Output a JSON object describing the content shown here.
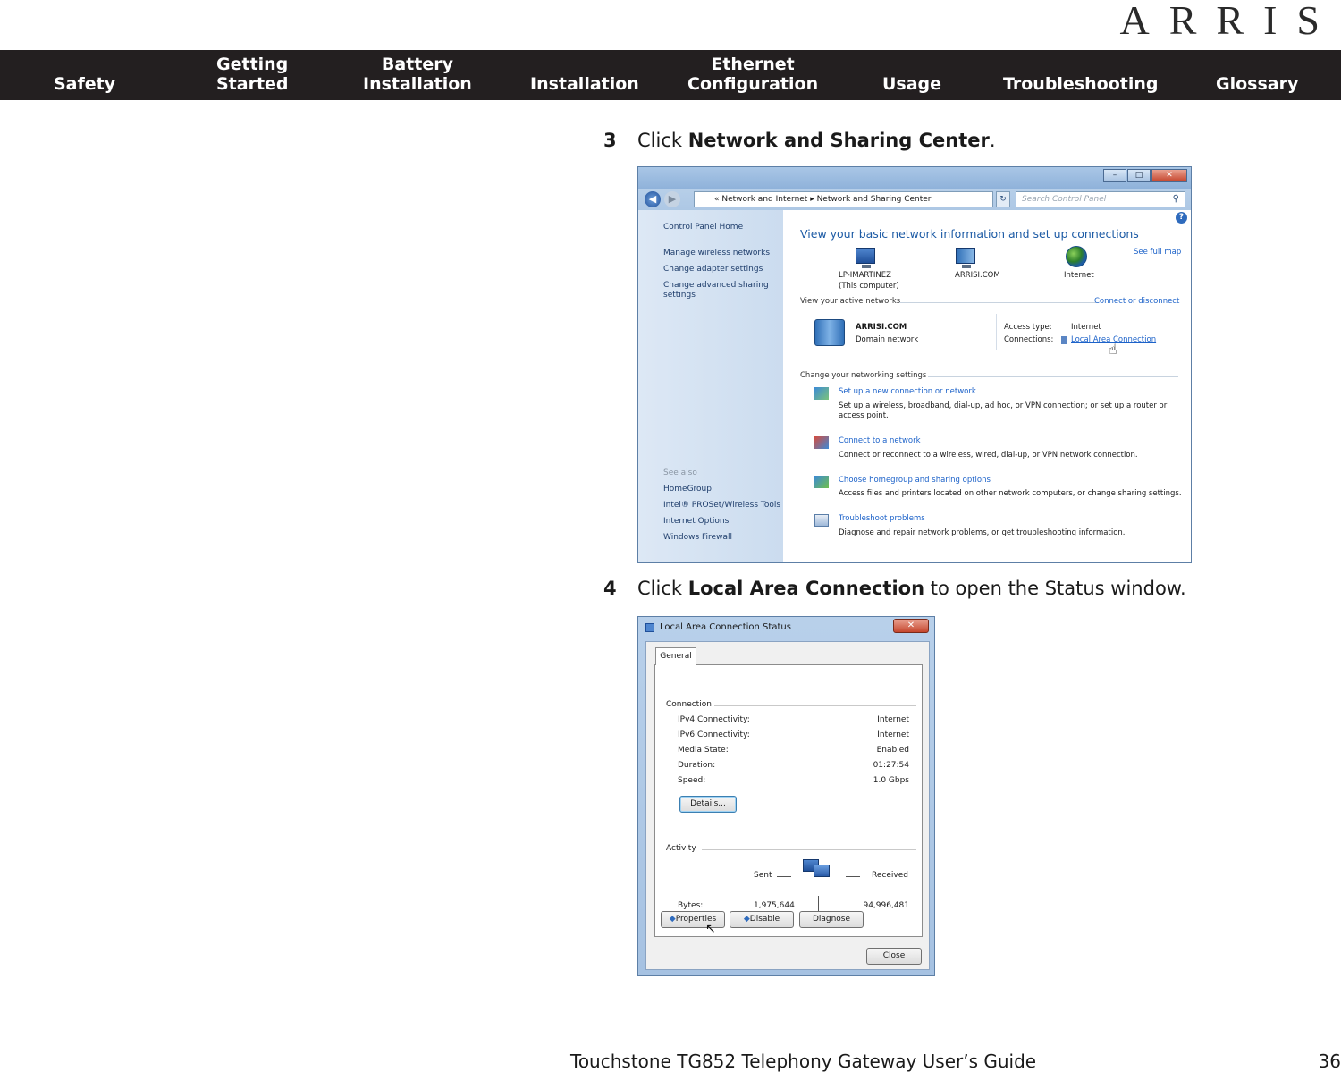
{
  "brand": {
    "logo": "ARRIS"
  },
  "nav": {
    "items": [
      {
        "l1": "Safety",
        "l2": ""
      },
      {
        "l1": "Getting",
        "l2": "Started"
      },
      {
        "l1": "Battery",
        "l2": "Installation"
      },
      {
        "l1": "Installation",
        "l2": ""
      },
      {
        "l1": "Ethernet",
        "l2": "Configuration"
      },
      {
        "l1": "Usage",
        "l2": ""
      },
      {
        "l1": "Troubleshooting",
        "l2": ""
      },
      {
        "l1": "Glossary",
        "l2": ""
      }
    ]
  },
  "steps": [
    {
      "num": "3",
      "pre": "Click ",
      "bold": "Network and Sharing Center",
      "post": "."
    },
    {
      "num": "4",
      "pre": "Click ",
      "bold": "Local Area Connection",
      "post": " to open the Status window."
    }
  ],
  "nsc": {
    "breadcrumb": "«  Network and Internet  ▸  Network and Sharing Center",
    "search_placeholder": "Search Control Panel",
    "sidebar": {
      "home": "Control Panel Home",
      "links": [
        "Manage wireless networks",
        "Change adapter settings",
        "Change advanced sharing",
        "settings"
      ],
      "see_also": "See also",
      "see_also_links": [
        "HomeGroup",
        "Intel® PROSet/Wireless Tools",
        "Internet Options",
        "Windows Firewall"
      ]
    },
    "title": "View your basic network information and set up connections",
    "see_full_map": "See full map",
    "map": {
      "computer": "LP-IMARTINEZ",
      "computer_sub": "(This computer)",
      "domain": "ARRISI.COM",
      "internet": "Internet"
    },
    "active_networks": "View your active networks",
    "connect_disconnect": "Connect or disconnect",
    "network": {
      "name": "ARRISI.COM",
      "type": "Domain network",
      "access_label": "Access type:",
      "access_value": "Internet",
      "conn_label": "Connections:",
      "conn_value": "Local Area Connection"
    },
    "change_settings": "Change your networking settings",
    "tasks": [
      {
        "title": "Set up a new connection or network",
        "desc1": "Set up a wireless, broadband, dial-up, ad hoc, or VPN connection; or set up a router or",
        "desc2": "access point."
      },
      {
        "title": "Connect to a network",
        "desc1": "Connect or reconnect to a wireless, wired, dial-up, or VPN network connection.",
        "desc2": ""
      },
      {
        "title": "Choose homegroup and sharing options",
        "desc1": "Access files and printers located on other network computers, or change sharing settings.",
        "desc2": ""
      },
      {
        "title": "Troubleshoot problems",
        "desc1": "Diagnose and repair network problems, or get troubleshooting information.",
        "desc2": ""
      }
    ]
  },
  "lac": {
    "title": "Local Area Connection Status",
    "tab": "General",
    "connection_header": "Connection",
    "rows": [
      {
        "label": "IPv4 Connectivity:",
        "value": "Internet"
      },
      {
        "label": "IPv6 Connectivity:",
        "value": "Internet"
      },
      {
        "label": "Media State:",
        "value": "Enabled"
      },
      {
        "label": "Duration:",
        "value": "01:27:54"
      },
      {
        "label": "Speed:",
        "value": "1.0 Gbps"
      }
    ],
    "details_button": "Details...",
    "activity_header": "Activity",
    "sent_label": "Sent",
    "received_label": "Received",
    "bytes_label": "Bytes:",
    "bytes_sent": "1,975,644",
    "bytes_received": "94,996,481",
    "buttons": {
      "properties": "Properties",
      "disable": "Disable",
      "diagnose": "Diagnose",
      "close": "Close"
    }
  },
  "footer": {
    "title": "Touchstone TG852 Telephony Gateway User’s Guide",
    "page": "36"
  }
}
